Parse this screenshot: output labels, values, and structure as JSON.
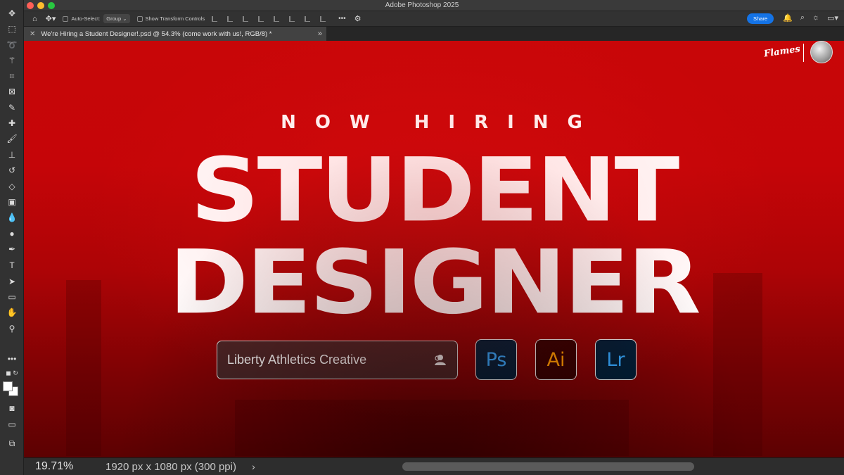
{
  "app": {
    "title": "Adobe Photoshop 2025"
  },
  "options_bar": {
    "auto_select_label": "Auto-Select:",
    "auto_select_value": "Group",
    "transform_label": "Show Transform Controls",
    "more": "•••",
    "share_label": "Share"
  },
  "document": {
    "tab_title": "We're Hiring a Student Designer!.psd @ 54.3% (come work with us!, RGB/8) *"
  },
  "canvas": {
    "logo_text": "Flames",
    "kicker": "NOW HIRING",
    "headline_line1": "STUDENT",
    "headline_line2": "DESIGNER",
    "name_pill": "Liberty Athletics Creative",
    "apps": [
      {
        "label": "Ps"
      },
      {
        "label": "Ai"
      },
      {
        "label": "Lr"
      }
    ]
  },
  "status_bar": {
    "zoom": "19.71%",
    "doc_info": "1920 px x 1080 px (300 ppi)"
  },
  "colors": {
    "canvas_red": "#c80608",
    "share_blue": "#1473e6",
    "ps_blue": "#31a8ff",
    "ai_orange": "#ff9a00"
  },
  "icons": [
    "move-icon",
    "marquee-icon",
    "lasso-icon",
    "magic-wand-icon",
    "crop-icon",
    "frame-icon",
    "eyedropper-icon",
    "healing-icon",
    "brush-icon",
    "stamp-icon",
    "history-brush-icon",
    "eraser-icon",
    "gradient-icon",
    "blur-icon",
    "dodge-icon",
    "pen-icon",
    "type-icon",
    "path-select-icon",
    "rectangle-icon",
    "hand-icon",
    "zoom-icon",
    "more-tools-icon",
    "home-icon",
    "bell-icon",
    "search-icon",
    "lightbulb-icon",
    "workspace-icon",
    "settings-icon",
    "user-icon"
  ]
}
